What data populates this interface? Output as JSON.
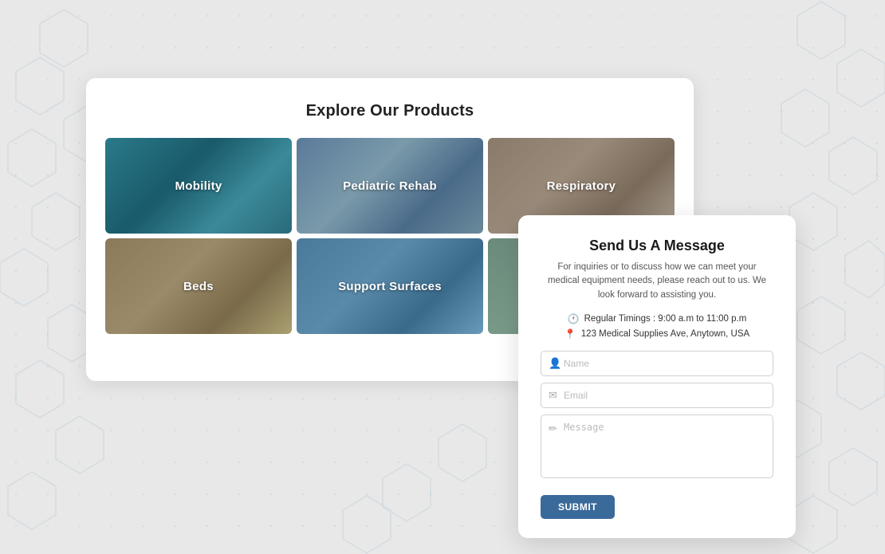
{
  "background": {
    "color": "#e8e8e8"
  },
  "productCard": {
    "title": "Explore Our Products",
    "items": [
      {
        "id": "mobility",
        "label": "Mobility",
        "bg": "mobility"
      },
      {
        "id": "pediatric-rehab",
        "label": "Pediatric Rehab",
        "bg": "pediatric"
      },
      {
        "id": "respiratory",
        "label": "Respiratory",
        "bg": "respiratory"
      },
      {
        "id": "beds",
        "label": "Beds",
        "bg": "beds"
      },
      {
        "id": "support-surfaces",
        "label": "Support Surfaces",
        "bg": "support"
      },
      {
        "id": "sixth",
        "label": "",
        "bg": "sixth"
      }
    ]
  },
  "contactCard": {
    "title": "Send Us A Message",
    "description": "For inquiries or to discuss how we can meet your medical equipment needs, please reach out to us. We look forward to assisting you.",
    "timings": "Regular Timings : 9:00 a.m to 11:00 p.m",
    "address": "123 Medical Supplies Ave, Anytown, USA",
    "form": {
      "namePlaceholder": "Name",
      "emailPlaceholder": "Email",
      "messagePlaceholder": "Message",
      "submitLabel": "SUBMIT"
    }
  }
}
